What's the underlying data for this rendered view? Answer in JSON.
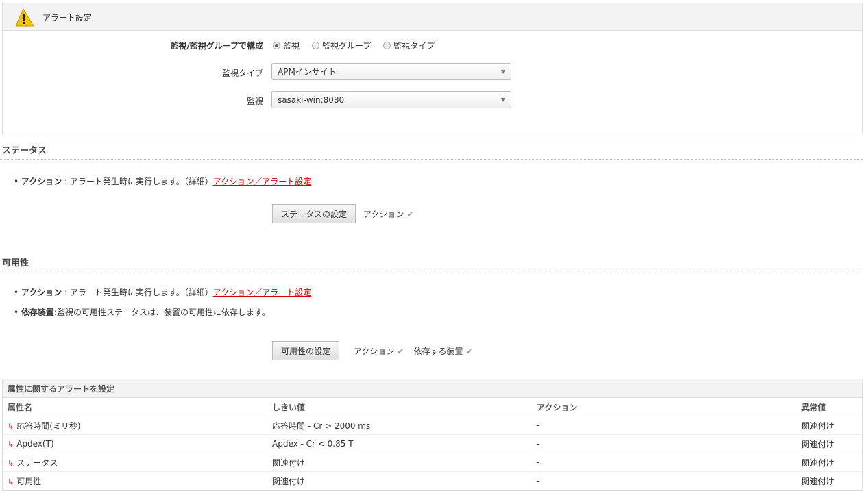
{
  "header": {
    "title": "アラート設定"
  },
  "config": {
    "compose_label": "監視/監視グループで構成",
    "radios": [
      {
        "label": "監視",
        "selected": true
      },
      {
        "label": "監視グループ",
        "selected": false
      },
      {
        "label": "監視タイプ",
        "selected": false
      }
    ],
    "monitor_type_label": "監視タイプ",
    "monitor_type_value": "APMインサイト",
    "monitor_label": "監視",
    "monitor_value": "sasaki-win:8080"
  },
  "status": {
    "heading": "ステータス",
    "action_bold": "アクション",
    "action_text": " : アラート発生時に実行します。（詳細）",
    "action_link": "アクション／アラート設定",
    "button": "ステータスの設定",
    "tag1": "アクション"
  },
  "availability": {
    "heading": "可用性",
    "action_bold": "アクション",
    "action_text": " : アラート発生時に実行します。（詳細）",
    "action_link": "アクション／アラート設定",
    "dep_bold": "依存装置",
    "dep_text": ":監視の可用性ステータスは、装置の可用性に依存します。",
    "button": "可用性の設定",
    "tag1": "アクション",
    "tag2": "依存する装置"
  },
  "attributes": {
    "title": "属性に関するアラートを設定",
    "columns": [
      "属性名",
      "しきい値",
      "アクション",
      "異常値"
    ],
    "rows": [
      [
        "応答時間(ミリ秒)",
        "応答時間 - Cr > 2000 ms",
        "-",
        "関連付け"
      ],
      [
        "Apdex(T)",
        "Apdex - Cr < 0.85 T",
        "-",
        "関連付け"
      ],
      [
        "ステータス",
        "関連付け",
        "-",
        "関連付け"
      ],
      [
        "可用性",
        "関連付け",
        "-",
        "関連付け"
      ]
    ]
  }
}
